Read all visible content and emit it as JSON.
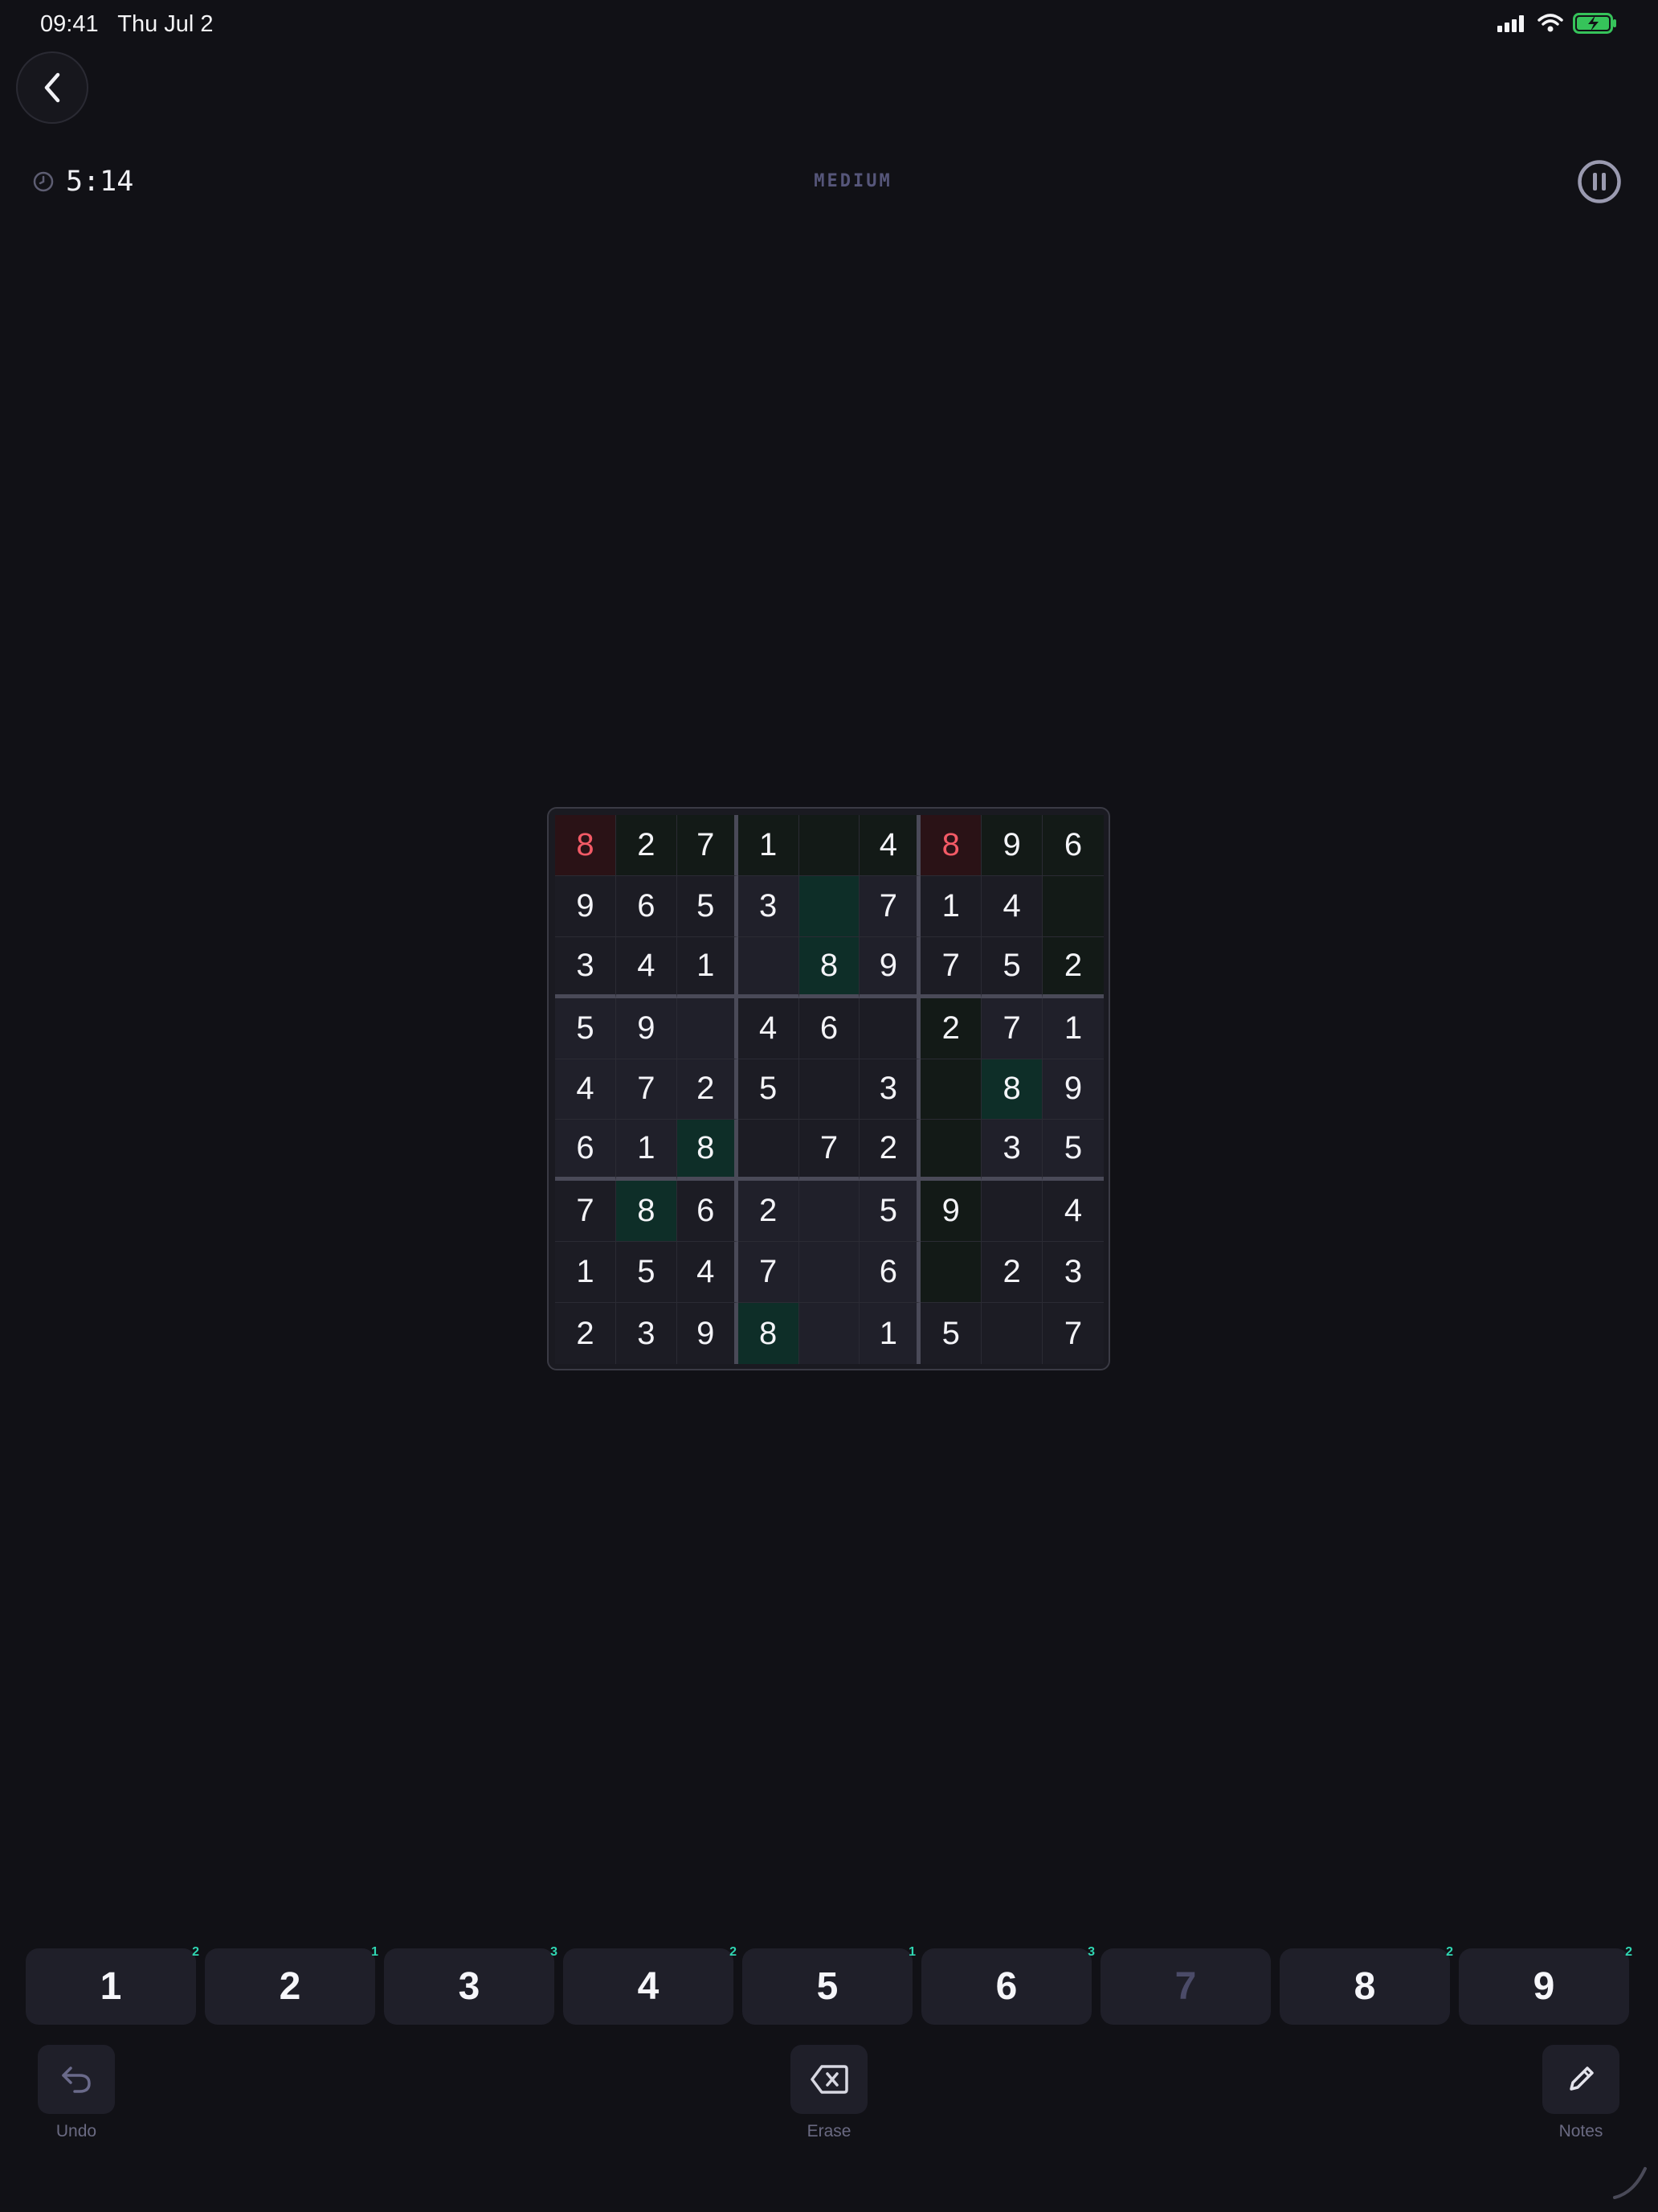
{
  "status_bar": {
    "time": "09:41",
    "date": "Thu Jul 2"
  },
  "game": {
    "timer": "5:14",
    "difficulty": "MEDIUM"
  },
  "board": {
    "rows": [
      [
        "8",
        "2",
        "7",
        "1",
        "",
        "4",
        "8",
        "9",
        "6"
      ],
      [
        "9",
        "6",
        "5",
        "3",
        "",
        "7",
        "1",
        "4",
        ""
      ],
      [
        "3",
        "4",
        "1",
        "",
        "8",
        "9",
        "7",
        "5",
        "2"
      ],
      [
        "5",
        "9",
        "",
        "4",
        "6",
        "",
        "2",
        "7",
        "1"
      ],
      [
        "4",
        "7",
        "2",
        "5",
        "",
        "3",
        "",
        "8",
        "9"
      ],
      [
        "6",
        "1",
        "8",
        "",
        "7",
        "2",
        "",
        "3",
        "5"
      ],
      [
        "7",
        "8",
        "6",
        "2",
        "",
        "5",
        "9",
        "",
        "4"
      ],
      [
        "1",
        "5",
        "4",
        "7",
        "",
        "6",
        "",
        "2",
        "3"
      ],
      [
        "2",
        "3",
        "9",
        "8",
        "",
        "1",
        "5",
        "",
        "7"
      ]
    ],
    "error_cells": [
      [
        0,
        0
      ],
      [
        0,
        6
      ]
    ],
    "matching_cells": [
      [
        1,
        4
      ],
      [
        2,
        4
      ],
      [
        4,
        7
      ],
      [
        5,
        2
      ],
      [
        6,
        1
      ],
      [
        8,
        3
      ]
    ],
    "tinted_cells": [
      [
        0,
        1
      ],
      [
        0,
        2
      ],
      [
        0,
        3
      ],
      [
        0,
        4
      ],
      [
        0,
        5
      ],
      [
        0,
        7
      ],
      [
        0,
        8
      ],
      [
        1,
        8
      ],
      [
        2,
        8
      ],
      [
        3,
        6
      ],
      [
        4,
        6
      ],
      [
        5,
        6
      ],
      [
        6,
        6
      ],
      [
        7,
        6
      ]
    ]
  },
  "numpad": [
    {
      "label": "1",
      "count": "2",
      "done": false
    },
    {
      "label": "2",
      "count": "1",
      "done": false
    },
    {
      "label": "3",
      "count": "3",
      "done": false
    },
    {
      "label": "4",
      "count": "2",
      "done": false
    },
    {
      "label": "5",
      "count": "1",
      "done": false
    },
    {
      "label": "6",
      "count": "3",
      "done": false
    },
    {
      "label": "7",
      "count": "",
      "done": true
    },
    {
      "label": "8",
      "count": "2",
      "done": false
    },
    {
      "label": "9",
      "count": "2",
      "done": false
    }
  ],
  "tools": {
    "undo": "Undo",
    "erase": "Erase",
    "notes": "Notes"
  },
  "icons": {
    "back": "chevron-left-icon",
    "timer": "clock-icon",
    "pause": "pause-icon",
    "undo": "undo-arrow-icon",
    "erase": "backspace-icon",
    "notes": "pencil-icon"
  },
  "colors": {
    "background": "#111116",
    "error": "#f25a66",
    "accent": "#2fd6b2",
    "match": "#0e2e28"
  }
}
